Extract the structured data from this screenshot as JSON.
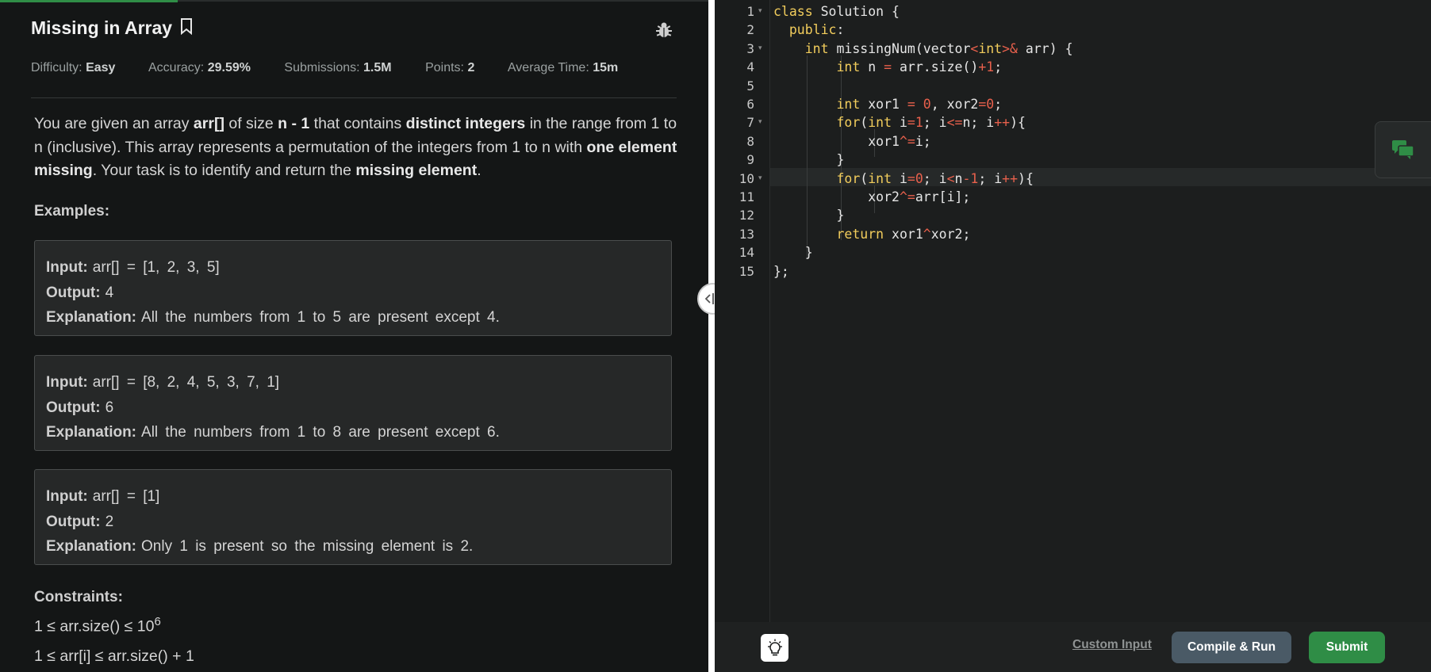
{
  "problem": {
    "title": "Missing in Array",
    "meta": [
      {
        "label": "Difficulty:",
        "value": "Easy"
      },
      {
        "label": "Accuracy:",
        "value": "29.59%"
      },
      {
        "label": "Submissions:",
        "value": "1.5M"
      },
      {
        "label": "Points:",
        "value": "2"
      },
      {
        "label": "Average Time:",
        "value": "15m"
      }
    ],
    "description": {
      "p1": "You are given an array ",
      "b1": "arr[]",
      "p2": " of size ",
      "b2": "n - 1",
      "p3": " that contains ",
      "b3": "distinct integers",
      "p4": " in the range from 1 to n (inclusive). This array represents a permutation of the integers from 1 to n with ",
      "b4": "one element missing",
      "p5": ". Your task is to identify and return the ",
      "b5": "missing element",
      "p6": "."
    },
    "examples_label": "Examples:",
    "examples": [
      {
        "input_label": "Input:",
        "input": "arr[] = [1, 2, 3, 5]",
        "output_label": "Output:",
        "output": "4",
        "explanation_label": "Explanation:",
        "explanation": "All the numbers from 1 to 5 are present except 4."
      },
      {
        "input_label": "Input:",
        "input": "arr[] = [8, 2, 4, 5, 3, 7, 1]",
        "output_label": "Output:",
        "output": "6",
        "explanation_label": "Explanation:",
        "explanation": "All the numbers from 1 to 8 are present except 6."
      },
      {
        "input_label": "Input:",
        "input": "arr[] = [1]",
        "output_label": "Output:",
        "output": "2",
        "explanation_label": "Explanation:",
        "explanation": "Only 1 is present so the missing element is 2."
      }
    ],
    "constraints_label": "Constraints:",
    "constraint1_base": "1 ≤ arr.size() ≤ 10",
    "constraint1_exp": "6",
    "constraint2": "1 ≤ arr[i] ≤ arr.size() + 1"
  },
  "editor": {
    "line_numbers": [
      "1",
      "2",
      "3",
      "4",
      "5",
      "6",
      "7",
      "8",
      "9",
      "10",
      "11",
      "12",
      "13",
      "14",
      "15"
    ],
    "fold_lines": [
      1,
      3,
      7,
      10
    ],
    "active_line": 10
  },
  "actions": {
    "custom_input": "Custom Input",
    "compile_run": "Compile & Run",
    "submit": "Submit"
  },
  "icons": {
    "bookmark": "bookmark-icon",
    "bug": "bug-icon",
    "splitter": "split-arrows-icon",
    "chat": "chat-icon",
    "bulb": "lightbulb-icon"
  },
  "colors": {
    "accent_green": "#2f8d46",
    "compile_bg": "#4a5a66",
    "keyword": "#f2cd5c",
    "number": "#e8604c"
  }
}
